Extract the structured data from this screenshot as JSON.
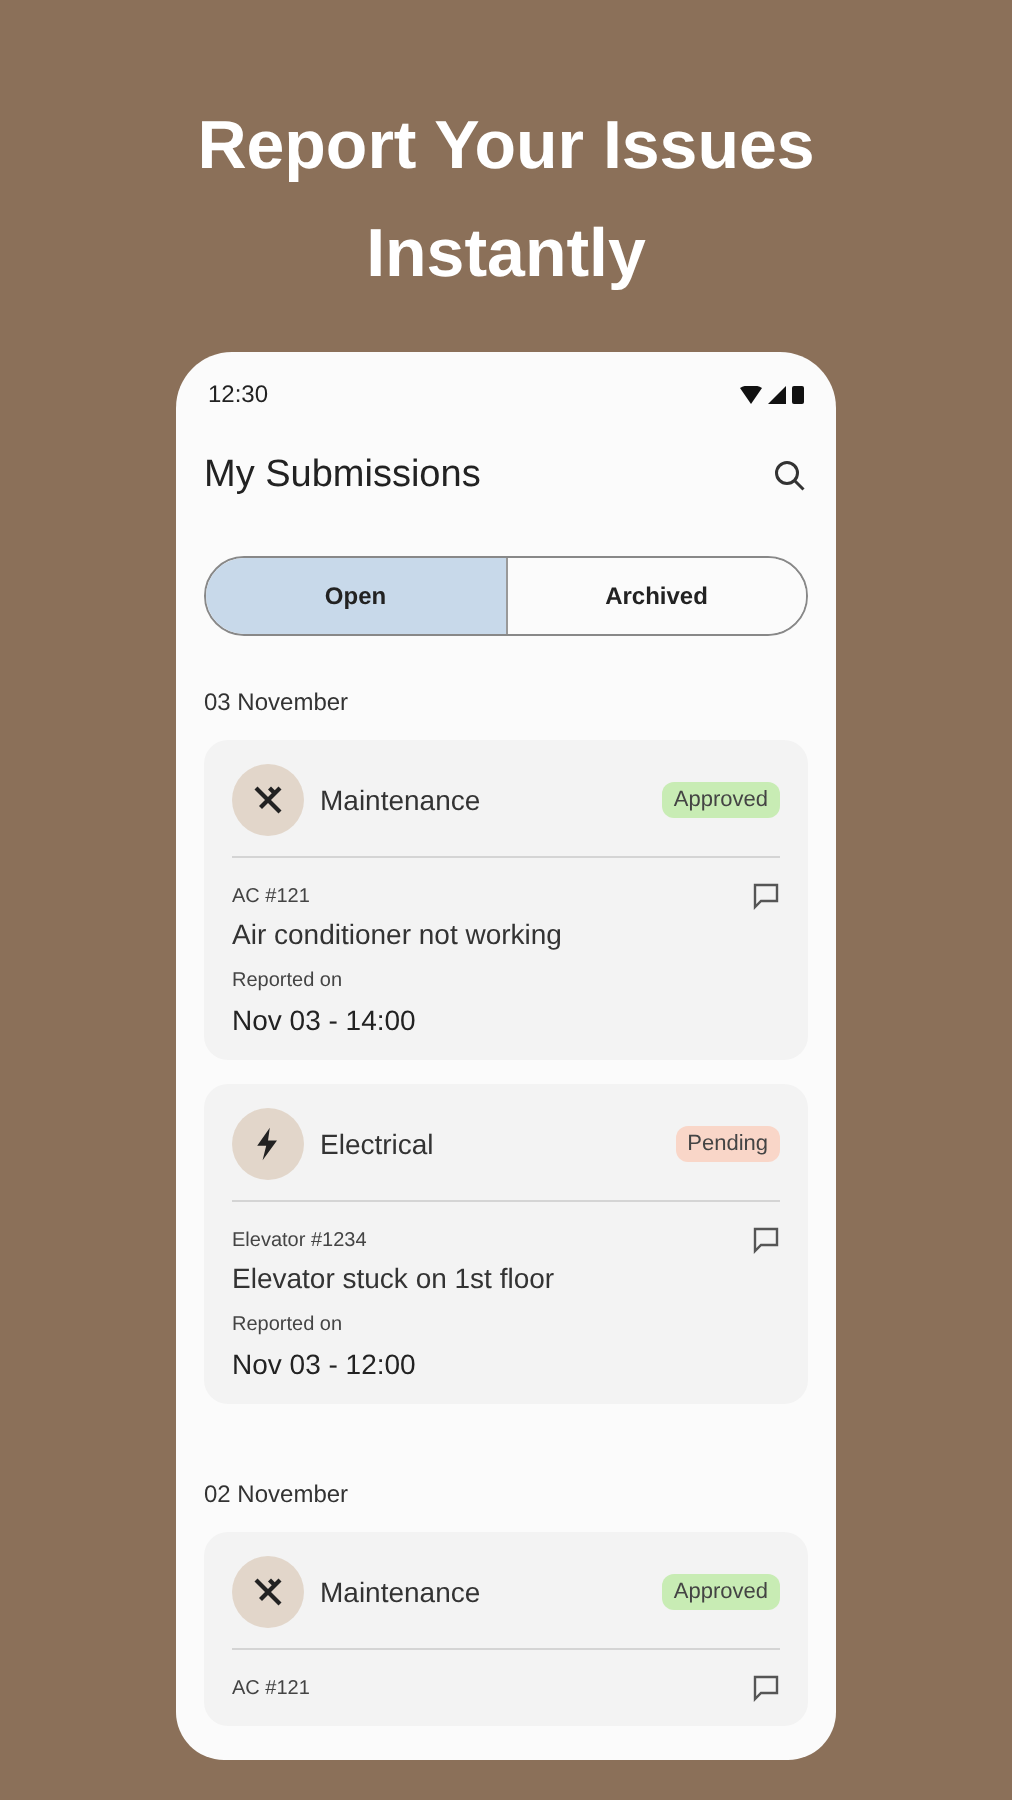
{
  "headline": "Report Your Issues Instantly",
  "status_bar": {
    "time": "12:30"
  },
  "app_bar": {
    "title": "My Submissions"
  },
  "tabs": [
    {
      "label": "Open",
      "selected": true
    },
    {
      "label": "Archived",
      "selected": false
    }
  ],
  "groups": [
    {
      "date": "03 November",
      "cards": [
        {
          "kind": "maintenance",
          "category": "Maintenance",
          "status": "Approved",
          "color": "#c8ecb4",
          "reference": "AC #121",
          "description": "Air conditioner not working",
          "reported_label": "Reported on",
          "reported_at": "Nov 03 - 14:00"
        },
        {
          "kind": "electrical",
          "category": "Electrical",
          "status": "Pending",
          "color": "#f9d6c8",
          "reference": "Elevator #1234",
          "description": "Elevator stuck on 1st floor",
          "reported_label": "Reported on",
          "reported_at": "Nov 03 - 12:00"
        }
      ]
    },
    {
      "date": "02 November",
      "cards": [
        {
          "kind": "maintenance",
          "category": "Maintenance",
          "status": "Approved",
          "color": "#c8ecb4",
          "reference": "AC #121"
        }
      ]
    }
  ]
}
